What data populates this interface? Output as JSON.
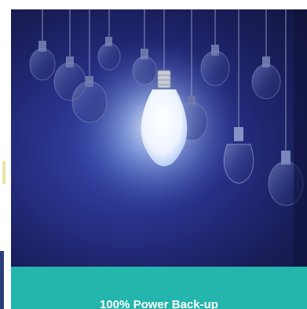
{
  "card": {
    "caption": "100% Power Back-up",
    "image_icon": "hanging-light-bulbs-image",
    "caption_bar_color": "#24b5ad",
    "hero_background_color": "#1f2a6e"
  }
}
